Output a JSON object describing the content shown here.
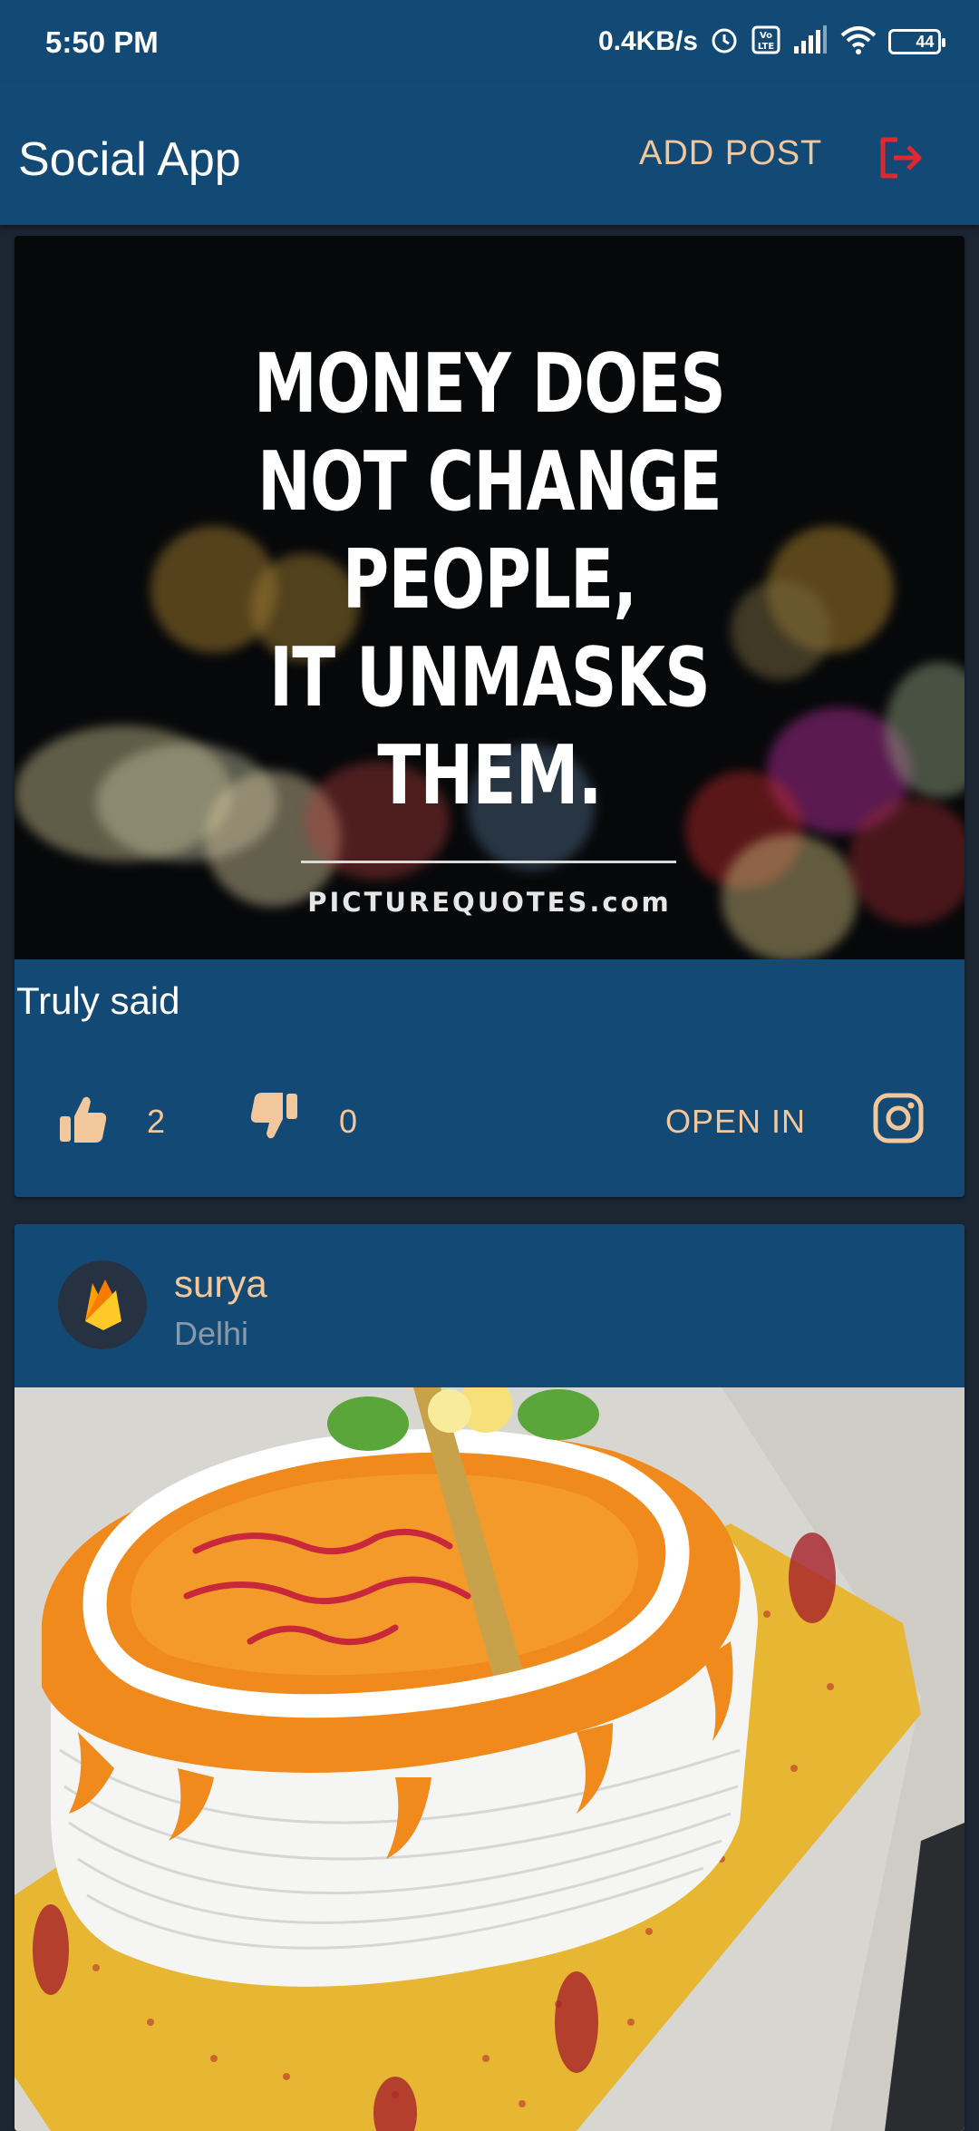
{
  "status_bar": {
    "time": "5:50 PM",
    "net_speed": "0.4KB/s",
    "battery": "44",
    "icons": [
      "alarm-icon",
      "volte-icon",
      "signal-icon",
      "wifi-icon",
      "battery-icon"
    ]
  },
  "app_bar": {
    "title": "Social App",
    "add_post_label": "ADD POST",
    "logout_icon": "logout-icon"
  },
  "posts": [
    {
      "image": {
        "type": "quote-image",
        "quote_lines": [
          "MONEY DOES",
          "NOT CHANGE",
          "PEOPLE,",
          "IT UNMASKS",
          "THEM."
        ],
        "brand": "PICTUREQUOTES.com"
      },
      "caption": "Truly said",
      "likes": "2",
      "dislikes": "0",
      "open_in_label": "OPEN IN",
      "open_in_icon": "instagram-icon"
    },
    {
      "author": "surya",
      "location": "Delhi",
      "avatar_icon": "firebase-icon",
      "image": {
        "type": "cake-photo"
      }
    }
  ],
  "colors": {
    "primary": "#124a75",
    "background": "#1c2633",
    "accent": "#f2c79c",
    "logout_red": "#e0282e"
  }
}
